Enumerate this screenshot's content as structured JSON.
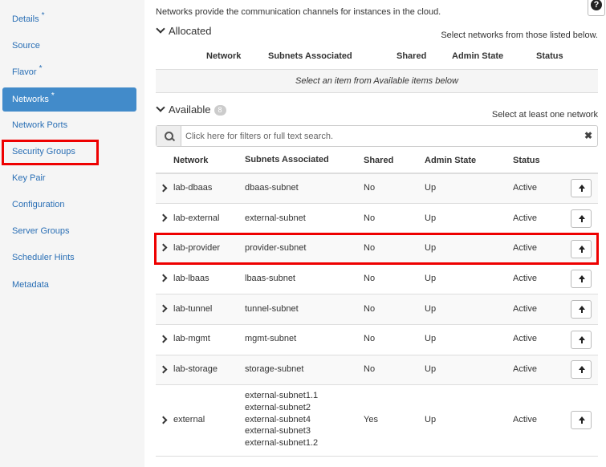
{
  "sidebar": {
    "items": [
      {
        "label": "Details",
        "required": "*",
        "active": false
      },
      {
        "label": "Source",
        "required": "",
        "active": false
      },
      {
        "label": "Flavor",
        "required": "*",
        "active": false
      },
      {
        "label": "Networks",
        "required": "*",
        "active": true
      },
      {
        "label": "Network Ports",
        "required": "",
        "active": false
      },
      {
        "label": "Security Groups",
        "required": "",
        "active": false
      },
      {
        "label": "Key Pair",
        "required": "",
        "active": false
      },
      {
        "label": "Configuration",
        "required": "",
        "active": false
      },
      {
        "label": "Server Groups",
        "required": "",
        "active": false
      },
      {
        "label": "Scheduler Hints",
        "required": "",
        "active": false
      },
      {
        "label": "Metadata",
        "required": "",
        "active": false
      }
    ]
  },
  "intro": "Networks provide the communication channels for instances in the cloud.",
  "help": "?",
  "allocated": {
    "title": "Allocated",
    "hint": "Select networks from those listed below.",
    "columns": [
      "Network",
      "Subnets Associated",
      "Shared",
      "Admin State",
      "Status"
    ],
    "empty": "Select an item from Available items below"
  },
  "available": {
    "title": "Available",
    "count": "8",
    "hint": "Select at least one network",
    "search_placeholder": "Click here for filters or full text search.",
    "clear": "✖",
    "columns": [
      "Network",
      "Subnets Associated",
      "Shared",
      "Admin State",
      "Status"
    ],
    "rows": [
      {
        "network": "lab-dbaas",
        "subnets": [
          "dbaas-subnet"
        ],
        "shared": "No",
        "admin": "Up",
        "status": "Active"
      },
      {
        "network": "lab-external",
        "subnets": [
          "external-subnet"
        ],
        "shared": "No",
        "admin": "Up",
        "status": "Active"
      },
      {
        "network": "lab-provider",
        "subnets": [
          "provider-subnet"
        ],
        "shared": "No",
        "admin": "Up",
        "status": "Active"
      },
      {
        "network": "lab-lbaas",
        "subnets": [
          "lbaas-subnet"
        ],
        "shared": "No",
        "admin": "Up",
        "status": "Active"
      },
      {
        "network": "lab-tunnel",
        "subnets": [
          "tunnel-subnet"
        ],
        "shared": "No",
        "admin": "Up",
        "status": "Active"
      },
      {
        "network": "lab-mgmt",
        "subnets": [
          "mgmt-subnet"
        ],
        "shared": "No",
        "admin": "Up",
        "status": "Active"
      },
      {
        "network": "lab-storage",
        "subnets": [
          "storage-subnet"
        ],
        "shared": "No",
        "admin": "Up",
        "status": "Active"
      },
      {
        "network": "external",
        "subnets": [
          "external-subnet1.1",
          "external-subnet2",
          "external-subnet4",
          "external-subnet3",
          "external-subnet1.2"
        ],
        "shared": "Yes",
        "admin": "Up",
        "status": "Active"
      }
    ]
  },
  "colors": {
    "accent": "#428bca",
    "highlight": "#e00000",
    "link": "#2a6fb5"
  }
}
